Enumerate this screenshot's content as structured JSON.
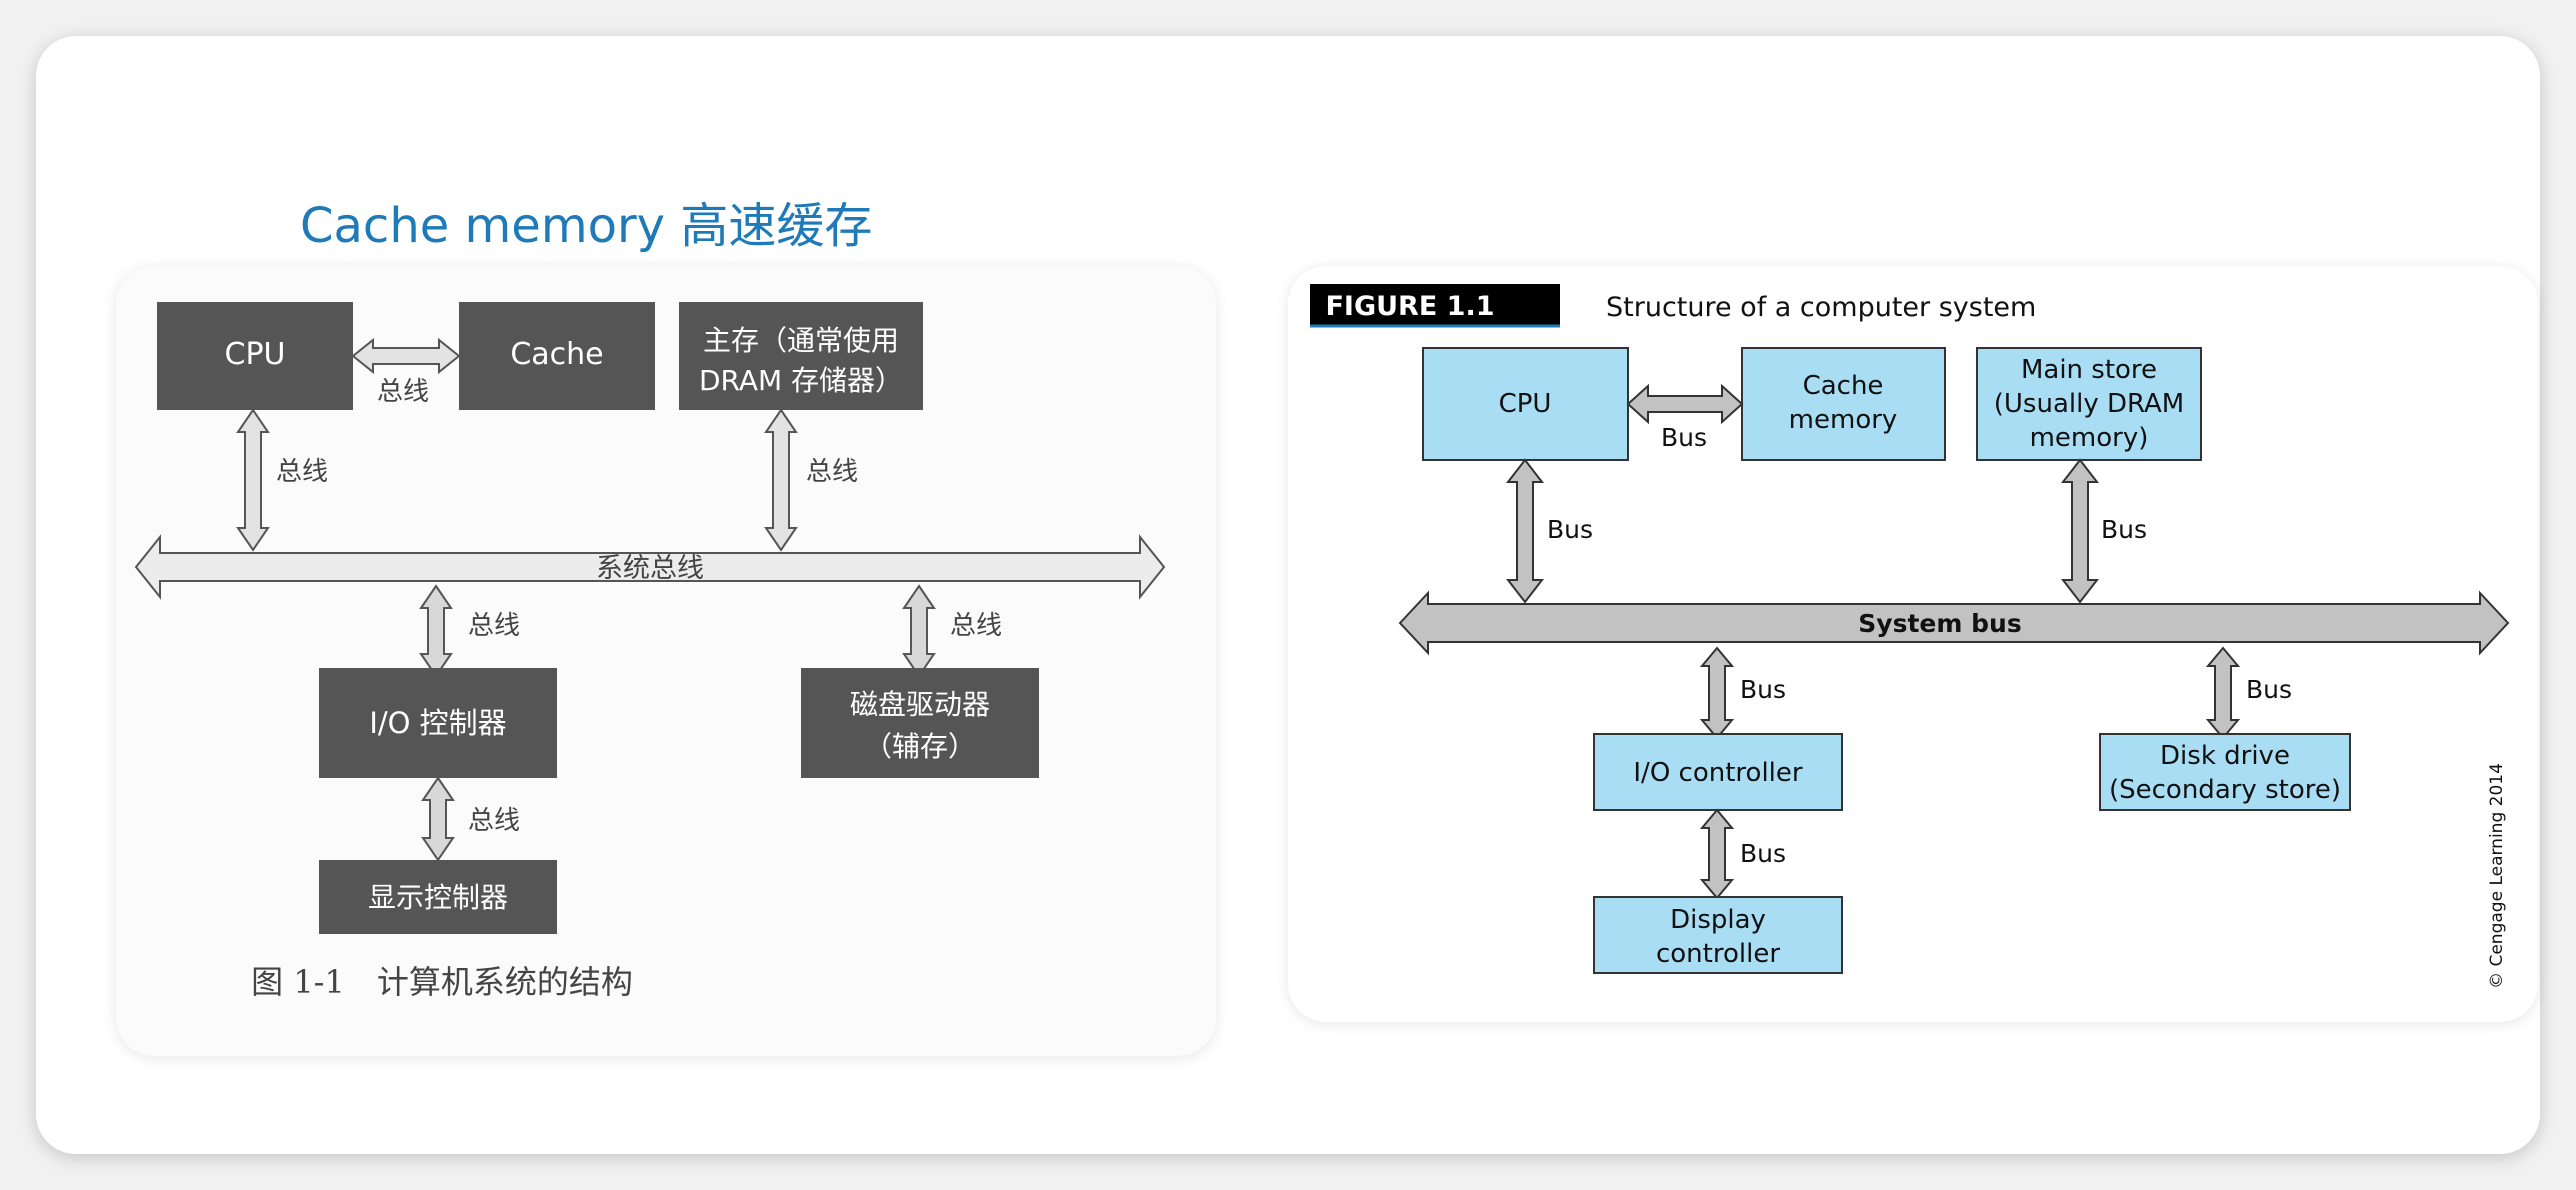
{
  "title": "Cache memory 高速缓存",
  "left_figure": {
    "cpu": "CPU",
    "cache": "Cache",
    "main_store_line1": "主存（通常使用",
    "main_store_line2": "DRAM 存储器）",
    "bus": "总线",
    "system_bus": "系统总线",
    "io_controller": "I/O 控制器",
    "disk_line1": "磁盘驱动器",
    "disk_line2": "（辅存）",
    "display_controller": "显示控制器",
    "caption": "图 1-1　计算机系统的结构"
  },
  "right_figure": {
    "figure_label": "FIGURE 1.1",
    "figure_title": "Structure of a computer system",
    "cpu": "CPU",
    "cache_line1": "Cache",
    "cache_line2": "memory",
    "main_line1": "Main store",
    "main_line2": "(Usually DRAM",
    "main_line3": "memory)",
    "bus": "Bus",
    "system_bus": "System bus",
    "io_controller": "I/O controller",
    "disk_line1": "Disk drive",
    "disk_line2": "(Secondary store)",
    "display_line1": "Display",
    "display_line2": "controller",
    "copyright": "© Cengage Learning 2014"
  },
  "colors": {
    "title": "#1e7ab8",
    "left_box": "#555555",
    "right_box": "#a9ddf3",
    "arrow_fill_left": "#e3e3e3",
    "arrow_fill_right": "#c2c2c2",
    "figure_label_bg": "#000000"
  }
}
